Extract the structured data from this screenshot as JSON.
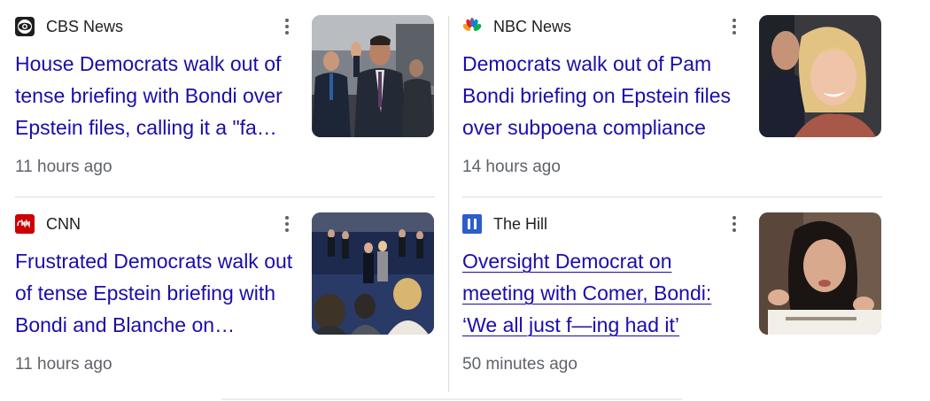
{
  "articles": [
    {
      "source": "CBS News",
      "source_icon": "cbs-eye-icon",
      "headline": "House Democrats walk out of tense briefing with Bondi over Epstein files, calling it a \"fa…",
      "time": "11 hours ago",
      "thumbnail": "photo-cbs-briefing"
    },
    {
      "source": "NBC News",
      "source_icon": "nbc-peacock-icon",
      "headline": "Democrats walk out of Pam Bondi briefing on Epstein files over subpoena compliance",
      "time": "14 hours ago",
      "thumbnail": "photo-nbc-bondi"
    },
    {
      "source": "CNN",
      "source_icon": "cnn-logo-icon",
      "headline": "Frustrated Democrats walk out of tense Epstein briefing with Bondi and Blanche on…",
      "time": "11 hours ago",
      "thumbnail": "photo-cnn-press"
    },
    {
      "source": "The Hill",
      "source_icon": "the-hill-logo-icon",
      "headline": "Oversight Democrat on meeting with Comer, Bondi: ‘We all just f—ing had it’",
      "time": "50 minutes ago",
      "thumbnail": "photo-hill-speaker"
    }
  ],
  "colors": {
    "headline": "#1a0dab",
    "meta": "#5f6368",
    "divider": "#dadce0",
    "cnn_red": "#cc0000",
    "hill_blue": "#2c5dc9"
  }
}
